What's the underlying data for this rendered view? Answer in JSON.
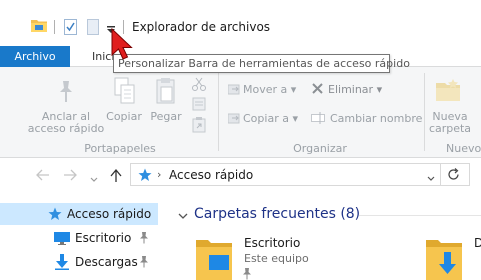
{
  "window": {
    "title": "Explorador de archivos"
  },
  "tabs": {
    "file": "Archivo",
    "home": "Inicio"
  },
  "tooltip": "Personalizar Barra de herramientas de acceso rápido",
  "ribbon": {
    "pin": "Anclar al acceso rápido",
    "pin_line1": "Anclar al",
    "pin_line2": "acceso rápido",
    "copy": "Copiar",
    "paste": "Pegar",
    "move_to": "Mover a",
    "delete": "Eliminar",
    "copy_to": "Copiar a",
    "rename": "Cambiar nombre",
    "new_folder_line1": "Nueva",
    "new_folder_line2": "carpeta",
    "groups": {
      "clipboard": "Portapapeles",
      "organize": "Organizar",
      "new": "Nuevo"
    }
  },
  "address": {
    "location": "Acceso rápido"
  },
  "nav": {
    "items": [
      {
        "label": "Acceso rápido"
      },
      {
        "label": "Escritorio"
      },
      {
        "label": "Descargas"
      }
    ]
  },
  "content": {
    "section_title": "Carpetas frecuentes (8)",
    "folders": [
      {
        "name": "Escritorio",
        "location": "Este equipo"
      },
      {
        "name": "D"
      }
    ]
  },
  "colors": {
    "accent": "#1979ca",
    "selected": "#cce8ff",
    "heading": "#1e3287"
  },
  "icons": [
    "folder-icon",
    "checkmark-icon",
    "qat-blank-icon",
    "dropdown-icon",
    "pin-icon",
    "copy-icon",
    "paste-icon",
    "scissors-icon",
    "move-icon",
    "delete-icon",
    "copy-to-icon",
    "rename-icon",
    "new-folder-icon",
    "back-icon",
    "forward-icon",
    "up-icon",
    "star-icon",
    "refresh-icon",
    "monitor-icon",
    "download-icon"
  ]
}
